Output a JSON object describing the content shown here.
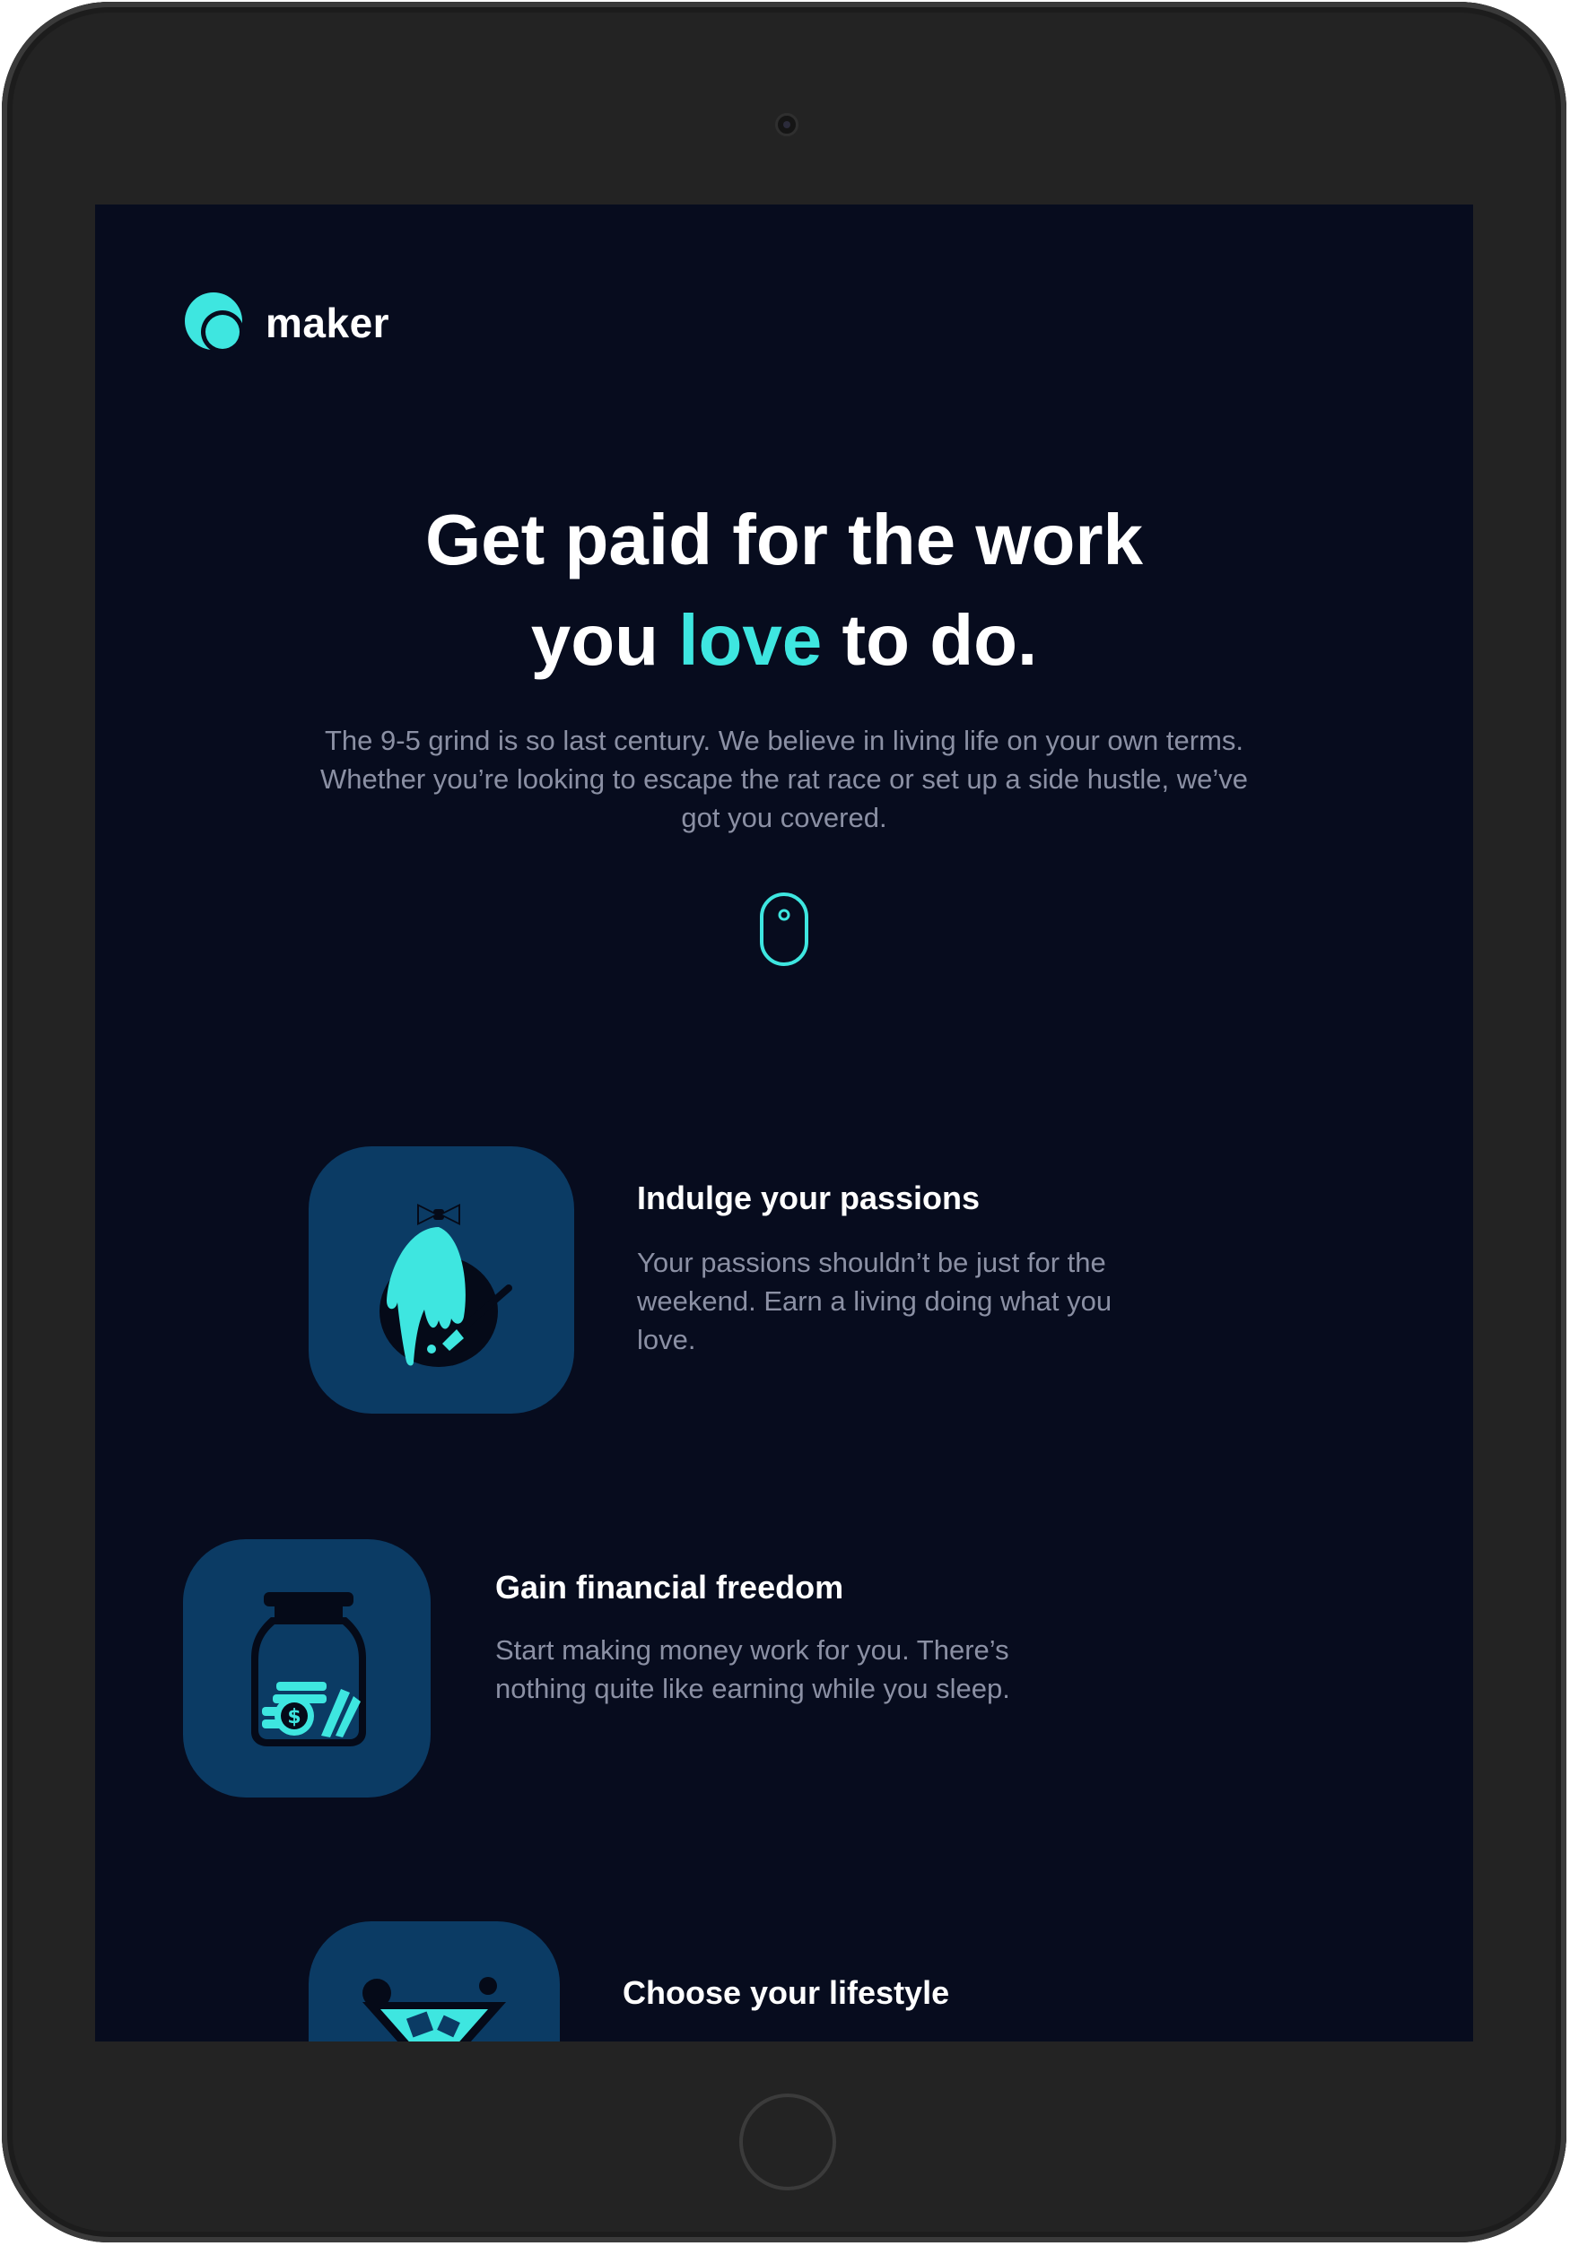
{
  "brand": {
    "name": "maker",
    "accent_color": "#3ee6e0",
    "background_color": "#070c1e",
    "tile_color": "#0b3b64"
  },
  "hero": {
    "headline_line1": "Get paid for the work",
    "headline_before": "you ",
    "headline_accent": "love",
    "headline_after": " to do.",
    "intro": "The 9-5 grind is so last century. We believe in living life on your own terms. Whether you’re looking to escape the rat race or set up a side hustle, we’ve got you covered.",
    "scroll_icon": "mouse-scroll-icon"
  },
  "features": [
    {
      "title": "Indulge your passions",
      "description": "Your passions shouldn’t be just for the weekend. Earn a living doing what you love.",
      "icon": "paint-drip-egg-icon"
    },
    {
      "title": "Gain financial freedom",
      "description": "Start making money work for you. There’s nothing quite like earning while you sleep.",
      "icon": "money-jar-icon"
    },
    {
      "title": "Choose your lifestyle",
      "description": "",
      "icon": "cocktail-glass-icon"
    }
  ]
}
